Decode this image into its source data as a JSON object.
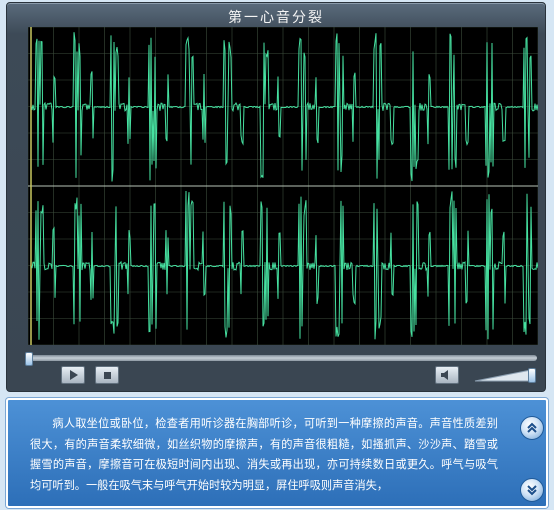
{
  "player": {
    "title": "第一心音分裂",
    "controls": {
      "play": "play-icon",
      "stop": "stop-icon",
      "volume": "speaker-icon"
    },
    "colors": {
      "waveform": "#46e0a0",
      "grid": "#3c4d3c",
      "axis": "#c8c860"
    }
  },
  "description": {
    "text": "病人取坐位或卧位，检查者用听诊器在胸部听诊，可听到一种摩擦的声音。声音性质差别很大，有的声音柔软细微，如丝织物的摩擦声，有的声音很粗糙，如搔抓声、沙沙声、踏雪或握雪的声音，摩擦音可在极短时间内出现、消失或再出现，亦可持续数日或更久。呼气与吸气均可听到。一般在吸气末与呼气开始时较为明显，屏住呼吸则声音消失，"
  }
}
